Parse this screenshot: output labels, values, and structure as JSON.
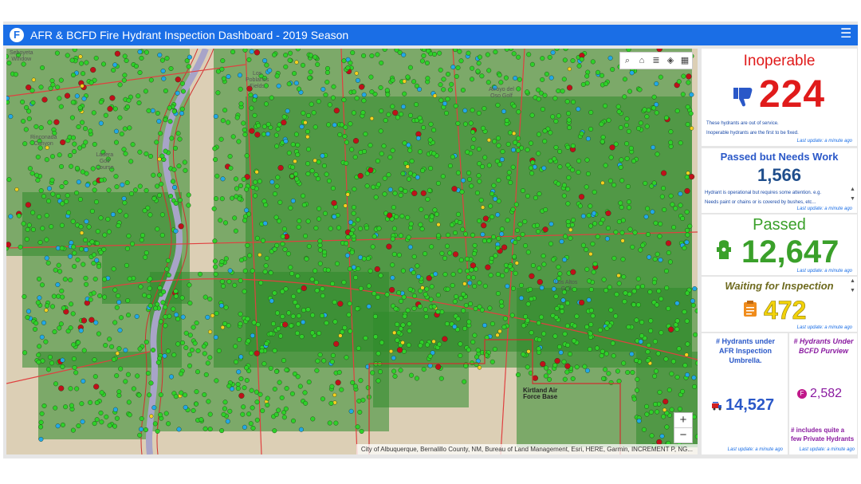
{
  "header": {
    "title": "AFR & BCFD Fire Hydrant Inspection Dashboard - 2019 Season",
    "logo_letter": "F"
  },
  "map": {
    "toolbar_icons": [
      "search-icon",
      "bookmark-icon",
      "list-icon",
      "layers-icon",
      "qr-code-icon"
    ],
    "zoom_in": "+",
    "zoom_out": "−",
    "attribution": "City of Albuquerque, Bernalillo County, NM, Bureau of Land Management, Esri, HERE, Garmin, INCREMENT P, NG...",
    "labels": {
      "seboyeta_window": "Seboyeta\nWindow",
      "rinconada_canyon": "Rinconada\nCanyon",
      "ladera_golf": "Ladera\nGolf\nCourse",
      "los_poblanos": "Los\nPoblanos\nFields",
      "arroyo_del_oso": "Arroyo del\nOso Golf",
      "kirtland_air_force_base": "Kirtland Air\nForce Base",
      "los_altos": "Los Altos\nGolf"
    }
  },
  "inoperable": {
    "title": "Inoperable",
    "value": "224",
    "desc1": "These hydrants are out of service.",
    "desc2": "Inoperable hydrants are the first to be fixed.",
    "updated": "Last update: a minute ago",
    "color": "#e01b1b"
  },
  "needs_work": {
    "title": "Passed but Needs Work",
    "value": "1,566",
    "desc1": "Hydrant is operational but requires some attention.  e.g.",
    "desc2": "Needs paint or chains or is covered by bushes, etc...",
    "updated": "Last update: a minute ago",
    "color": "#1f4e8c"
  },
  "passed": {
    "title": "Passed",
    "value": "12,647",
    "updated": "Last update: a minute ago",
    "color": "#3aa02a"
  },
  "waiting": {
    "title": "Waiting for Inspection",
    "value": "472",
    "updated": "Last update: a minute ago",
    "color": "#6e6a1e",
    "value_color": "#f2d20a"
  },
  "afr": {
    "title": "# Hydrants under AFR Inspection Umbrella.",
    "value": "14,527",
    "updated": "Last update: a minute ago",
    "color": "#2a58c8"
  },
  "bcfd": {
    "title": "# Hydrants Under BCFD Purview",
    "value": "2,582",
    "note": "# includes quite a few Private Hydrants",
    "updated": "Last update: a minute ago",
    "color": "#8a1aa0"
  }
}
